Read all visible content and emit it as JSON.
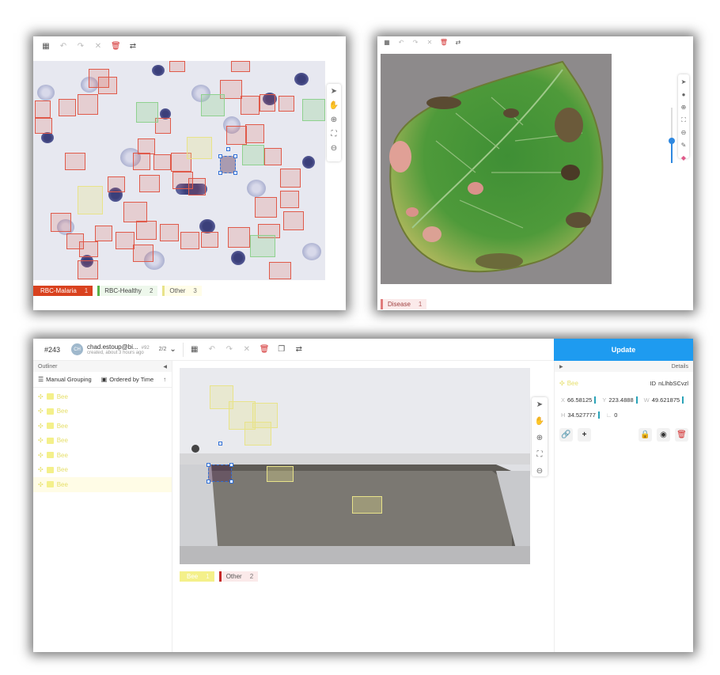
{
  "panel_a": {
    "label_bar": [
      {
        "name": "RBC-Malaria",
        "count": "1",
        "color": "#d9421f",
        "text_color": "#ffffff",
        "bg": "#d9421f"
      },
      {
        "name": "RBC-Healthy",
        "count": "2",
        "color": "#59b24a",
        "text_color": "#444444",
        "bg": "#eef8ec"
      },
      {
        "name": "Other",
        "count": "3",
        "color": "#e8e38a",
        "text_color": "#555555",
        "bg": "#fffde8"
      }
    ]
  },
  "panel_b": {
    "label_bar": [
      {
        "name": "Disease",
        "count": "1",
        "color": "#e07a7a",
        "text_color": "#a04040",
        "bg": "#fbeaea"
      }
    ]
  },
  "panel_c": {
    "task_id": "#243",
    "avatar_initials": "CH",
    "user_email": "chad.estoup@bi...",
    "user_number": "#92",
    "created": "created, about 3 hours ago",
    "pagination": "2/2",
    "update_label": "Update",
    "outliner_label": "Outliner",
    "details_label": "Details",
    "manual_grouping": "Manual Grouping",
    "ordered_by_time": "Ordered by Time",
    "outliner_items": [
      "Bee",
      "Bee",
      "Bee",
      "Bee",
      "Bee",
      "Bee",
      "Bee"
    ],
    "details": {
      "region_label": "Bee",
      "id_key": "ID",
      "id_value": "nLlhbSCvzl",
      "x_key": "X",
      "x_value": "66.58125",
      "y_key": "Y",
      "y_value": "223.4888",
      "w_key": "W",
      "w_value": "49.621875",
      "h_key": "H",
      "h_value": "34.527777",
      "l_key": "∟",
      "l_value": "0"
    },
    "label_bar": [
      {
        "name": "Bee",
        "count": "1",
        "color": "#f4f08a",
        "text_color": "#ffffff",
        "bg": "#f4f08a"
      },
      {
        "name": "Other",
        "count": "2",
        "color": "#c62828",
        "text_color": "#555555",
        "bg": "#fbeaea"
      }
    ]
  },
  "icons": {
    "grid": "grid-icon",
    "undo": "undo-icon",
    "redo": "redo-icon",
    "close": "close-icon",
    "trash": "trash-icon",
    "swap": "swap-icon",
    "pointer": "pointer-icon",
    "hand": "hand-icon",
    "zoom_in": "zoom-in-icon",
    "fit": "fit-icon",
    "zoom_out": "zoom-out-icon"
  },
  "colors": {
    "accent_blue": "#1e9bf0",
    "malaria_red": "#e05a4a",
    "healthy_green": "#8fd18f",
    "other_yellow": "#e8e38a"
  }
}
